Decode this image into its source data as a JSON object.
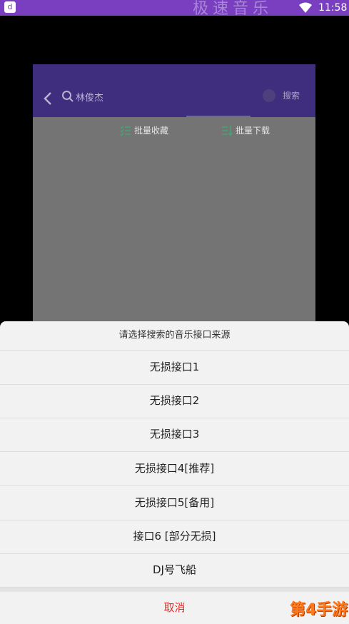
{
  "status_bar": {
    "time": "11:58",
    "app_icon_glyph": "d",
    "banner_text": "极速音乐"
  },
  "search": {
    "query": "林俊杰",
    "button_label": "搜索"
  },
  "batch_actions": {
    "collect_label": "批量收藏",
    "download_label": "批量下载"
  },
  "sheet": {
    "title": "请选择搜索的音乐接口来源",
    "options": [
      "无损接口1",
      "无损接口2",
      "无损接口3",
      "无损接口4[推荐]",
      "无损接口5[备用]",
      "接口6 [部分无损]",
      "DJ号飞船"
    ],
    "cancel_label": "取消"
  },
  "watermark": "第4手游",
  "colors": {
    "status_bar": "#7a3fc0",
    "header": "#3f2d7d",
    "cancel": "#e0302a",
    "watermark": "#ff7a1a"
  },
  "icons": [
    "back-arrow-icon",
    "search-icon",
    "clear-icon",
    "checklist-icon",
    "download-list-icon",
    "wifi-icon"
  ]
}
